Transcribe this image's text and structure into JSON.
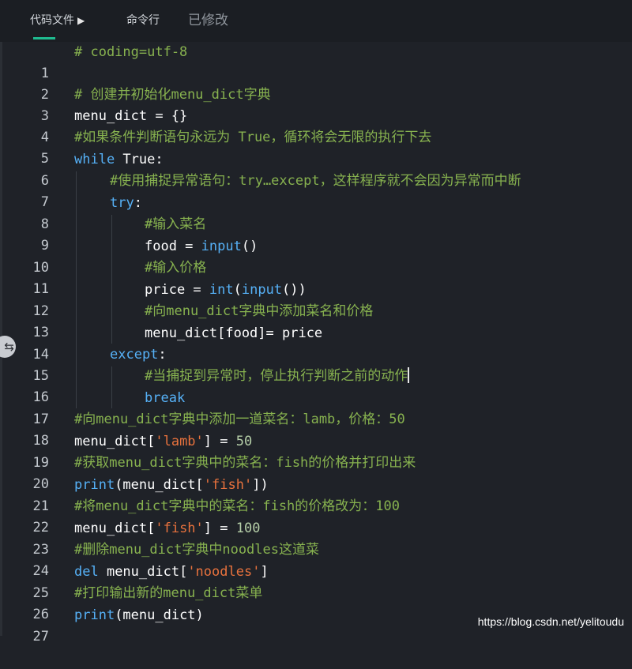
{
  "tabs": {
    "code_file": "代码文件",
    "code_file_arrow": "▶",
    "command_line": "命令行",
    "status": "已修改"
  },
  "editor": {
    "lines": [
      {
        "num": "1"
      },
      {
        "num": "2"
      },
      {
        "num": "3"
      },
      {
        "num": "4"
      },
      {
        "num": "5"
      },
      {
        "num": "6"
      },
      {
        "num": "7"
      },
      {
        "num": "8"
      },
      {
        "num": "9"
      },
      {
        "num": "10"
      },
      {
        "num": "11"
      },
      {
        "num": "12"
      },
      {
        "num": "13"
      },
      {
        "num": "14"
      },
      {
        "num": "15"
      },
      {
        "num": "16"
      },
      {
        "num": "17"
      },
      {
        "num": "18"
      },
      {
        "num": "19"
      },
      {
        "num": "20"
      },
      {
        "num": "21"
      },
      {
        "num": "22"
      },
      {
        "num": "23"
      },
      {
        "num": "24"
      },
      {
        "num": "25"
      },
      {
        "num": "26"
      },
      {
        "num": "27"
      }
    ],
    "code": {
      "l1": "# coding=utf-8",
      "l3": "# 创建并初始化menu_dict字典",
      "l4a": "menu_dict = {}",
      "l5": "#如果条件判断语句永远为 True，循环将会无限的执行下去",
      "l6k": "while",
      "l6b": " True:",
      "l7": "#使用捕捉异常语句：try…except，这样程序就不会因为异常而中断",
      "l8k": "try",
      "l8b": ":",
      "l9": "#输入菜名",
      "l10a": "food = ",
      "l10k": "input",
      "l10b": "()",
      "l11": "#输入价格",
      "l12a": "price = ",
      "l12k1": "int",
      "l12b": "(",
      "l12k2": "input",
      "l12c": "())",
      "l13": "#向menu_dict字典中添加菜名和价格",
      "l14": "menu_dict[food]= price",
      "l15k": "except",
      "l15b": ":",
      "l16": "#当捕捉到异常时，停止执行判断之前的动作",
      "l17k": "break",
      "l18": "#向menu_dict字典中添加一道菜名：lamb，价格：50",
      "l19a": "menu_dict[",
      "l19s": "'lamb'",
      "l19b": "] = ",
      "l19n": "50",
      "l20": "#获取menu_dict字典中的菜名：fish的价格并打印出来",
      "l21k": "print",
      "l21a": "(menu_dict[",
      "l21s": "'fish'",
      "l21b": "])",
      "l22": "#将menu_dict字典中的菜名：fish的价格改为：100",
      "l23a": "menu_dict[",
      "l23s": "'fish'",
      "l23b": "] = ",
      "l23n": "100",
      "l24": "#删除menu_dict字典中noodles这道菜",
      "l25k": "del",
      "l25a": " menu_dict[",
      "l25s": "'noodles'",
      "l25b": "]",
      "l26": "#打印输出新的menu_dict菜单",
      "l27k": "print",
      "l27a": "(menu_dict)"
    }
  },
  "collapse_handle_icon": "⇆",
  "watermark": "https://blog.csdn.net/yelitoudu",
  "colors": {
    "background": "#1f2228",
    "comment": "#87b24f",
    "keyword": "#56b1f7",
    "string": "#e8723d",
    "number": "#b5cea8",
    "accent": "#1fbc90"
  }
}
